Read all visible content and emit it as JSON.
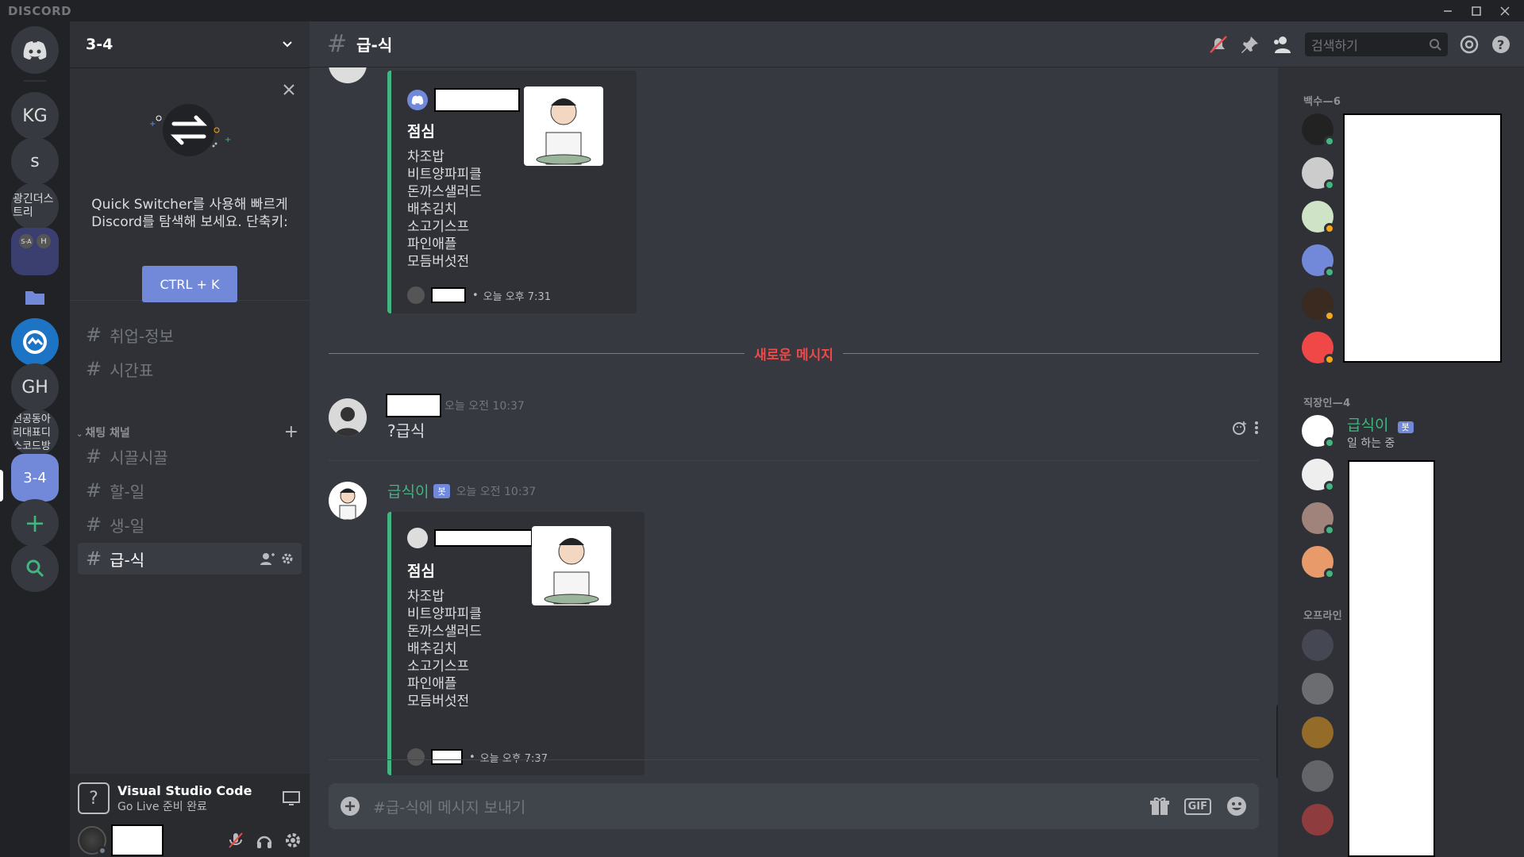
{
  "app": {
    "brand": "DISCORD"
  },
  "guilds": {
    "items": [
      {
        "label": "KG"
      },
      {
        "label": "s"
      },
      {
        "label": "광긴더스트리"
      },
      {
        "label": "S-A H"
      },
      {
        "label": ""
      },
      {
        "label": ""
      },
      {
        "label": "GH"
      },
      {
        "label": "선공동아리대표디스코드방"
      },
      {
        "label": "3-4"
      }
    ]
  },
  "sidebar": {
    "guild_name": "3-4",
    "quick_switcher": {
      "text": "Quick Switcher를 사용해 빠르게 Discord를 탐색해 보세요. 단축키:",
      "button": "CTRL + K"
    },
    "channels_top": [
      {
        "name": "취업-정보"
      },
      {
        "name": "시간표"
      }
    ],
    "category": "채팅 채널",
    "channels": [
      {
        "name": "시끌시끌"
      },
      {
        "name": "할-일"
      },
      {
        "name": "생-일"
      },
      {
        "name": "급-식"
      }
    ],
    "activity": {
      "title": "Visual Studio Code",
      "subtitle": "Go Live 준비 완료"
    }
  },
  "header": {
    "channel": "급-식",
    "search_placeholder": "검색하기"
  },
  "messages": {
    "embed1": {
      "title": "점심",
      "menu": [
        "차조밥",
        "비트양파피클",
        "돈까스샐러드",
        "배추김치",
        "소고기스프",
        "파인애플",
        "모듬버섯전"
      ],
      "footer_time": "오늘 오후 7:31"
    },
    "divider": "새로운 메시지",
    "msg1": {
      "time": "오늘 오전 10:37",
      "text": "?급식"
    },
    "msg2": {
      "author": "급식이",
      "bot_tag": "봇",
      "time": "오늘 오전 10:37",
      "embed": {
        "title": "점심",
        "menu": [
          "차조밥",
          "비트양파피클",
          "돈까스샐러드",
          "배추김치",
          "소고기스프",
          "파인애플",
          "모듬버섯전"
        ],
        "footer_time": "오늘 오후 7:37"
      }
    }
  },
  "composer": {
    "placeholder": "#급-식에 메시지 보내기",
    "gif": "GIF"
  },
  "members": {
    "group1": "백수—6",
    "group2": "직장인—4",
    "bot_member": {
      "name": "급식이",
      "tag": "봇",
      "status": "일 하는 중"
    },
    "group3": "오프라인"
  },
  "colors": {
    "accent": "#7289da",
    "online": "#43b581",
    "new_messages": "#f04747",
    "bot_name": "#43b581"
  }
}
